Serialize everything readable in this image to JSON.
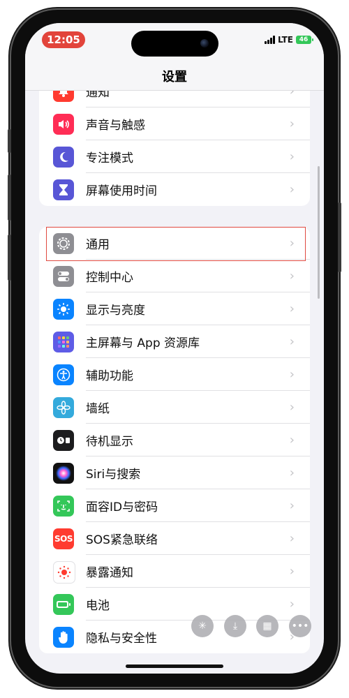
{
  "status_bar": {
    "time": "12:05",
    "network": "LTE",
    "battery": "46"
  },
  "nav": {
    "title": "设置"
  },
  "group1": [
    {
      "label": "通知",
      "icon": "bell-icon",
      "color": "#ff3b30"
    },
    {
      "label": "声音与触感",
      "icon": "speaker-icon",
      "color": "#ff2d55"
    },
    {
      "label": "专注模式",
      "icon": "moon-icon",
      "color": "#5856d6"
    },
    {
      "label": "屏幕使用时间",
      "icon": "hourglass-icon",
      "color": "#5856d6"
    }
  ],
  "group2": [
    {
      "label": "通用",
      "icon": "gear-icon",
      "color": "#8e8e93"
    },
    {
      "label": "控制中心",
      "icon": "toggles-icon",
      "color": "#8e8e93"
    },
    {
      "label": "显示与亮度",
      "icon": "sun-icon",
      "color": "#0a84ff"
    },
    {
      "label": "主屏幕与 App 资源库",
      "icon": "app-grid-icon",
      "color": "#5e5ce6"
    },
    {
      "label": "辅助功能",
      "icon": "accessibility-icon",
      "color": "#0a84ff"
    },
    {
      "label": "墙纸",
      "icon": "flower-icon",
      "color": "#34aadc"
    },
    {
      "label": "待机显示",
      "icon": "standby-icon",
      "color": "#1c1c1e"
    },
    {
      "label": "Siri与搜索",
      "icon": "siri-icon",
      "color": "#2c2c2e"
    },
    {
      "label": "面容ID与密码",
      "icon": "faceid-icon",
      "color": "#34c759"
    },
    {
      "label": "SOS紧急联络",
      "icon": "sos-icon",
      "color": "#ff3b30"
    },
    {
      "label": "暴露通知",
      "icon": "exposure-icon",
      "color": "#ffffff"
    },
    {
      "label": "电池",
      "icon": "battery-icon",
      "color": "#34c759"
    },
    {
      "label": "隐私与安全性",
      "icon": "hand-icon",
      "color": "#0a84ff"
    }
  ],
  "sos_text": "SOS",
  "chevron": "›",
  "highlight_color": "#e04a40"
}
